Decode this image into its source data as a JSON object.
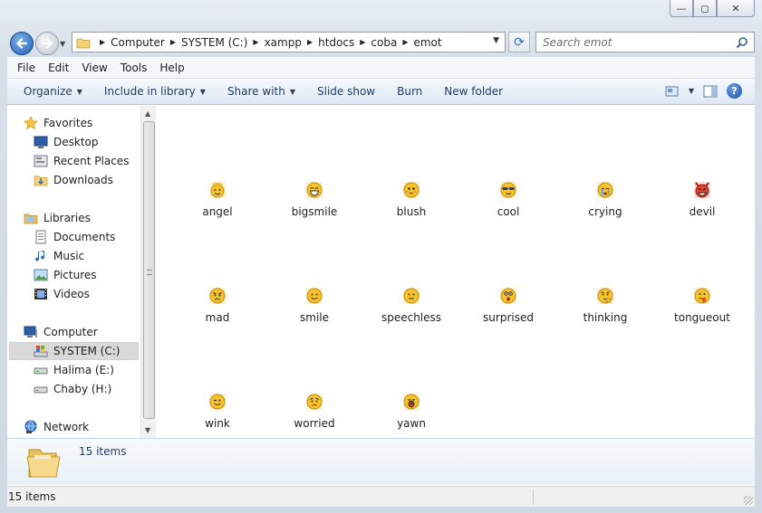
{
  "window": {
    "controls": {
      "minimize": "—",
      "maximize": "◻",
      "close": "✕"
    }
  },
  "address": {
    "breadcrumbs": [
      "Computer",
      "SYSTEM (C:)",
      "xampp",
      "htdocs",
      "coba",
      "emot"
    ]
  },
  "search": {
    "placeholder": "Search emot"
  },
  "menu": {
    "items": [
      "File",
      "Edit",
      "View",
      "Tools",
      "Help"
    ]
  },
  "toolbar": {
    "organize": "Organize",
    "include_in_library": "Include in library",
    "share_with": "Share with",
    "slide_show": "Slide show",
    "burn": "Burn",
    "new_folder": "New folder"
  },
  "nav": {
    "favorites": "Favorites",
    "desktop": "Desktop",
    "recent_places": "Recent Places",
    "downloads": "Downloads",
    "libraries": "Libraries",
    "documents": "Documents",
    "music": "Music",
    "pictures": "Pictures",
    "videos": "Videos",
    "computer": "Computer",
    "system_c": "SYSTEM (C:)",
    "halima_e": "Halima (E:)",
    "chaby_h": "Chaby (H:)",
    "network": "Network"
  },
  "files": [
    {
      "name": "angel",
      "icon": "angel-emoticon-icon"
    },
    {
      "name": "bigsmile",
      "icon": "bigsmile-emoticon-icon"
    },
    {
      "name": "blush",
      "icon": "blush-emoticon-icon"
    },
    {
      "name": "cool",
      "icon": "cool-emoticon-icon"
    },
    {
      "name": "crying",
      "icon": "crying-emoticon-icon"
    },
    {
      "name": "devil",
      "icon": "devil-emoticon-icon"
    },
    {
      "name": "mad",
      "icon": "mad-emoticon-icon"
    },
    {
      "name": "smile",
      "icon": "smile-emoticon-icon"
    },
    {
      "name": "speechless",
      "icon": "speechless-emoticon-icon"
    },
    {
      "name": "surprised",
      "icon": "surprised-emoticon-icon"
    },
    {
      "name": "thinking",
      "icon": "thinking-emoticon-icon"
    },
    {
      "name": "tongueout",
      "icon": "tongueout-emoticon-icon"
    },
    {
      "name": "wink",
      "icon": "wink-emoticon-icon"
    },
    {
      "name": "worried",
      "icon": "worried-emoticon-icon"
    },
    {
      "name": "yawn",
      "icon": "yawn-emoticon-icon"
    }
  ],
  "details": {
    "count": "15 items"
  },
  "status": {
    "text": "15 items"
  },
  "colors": {
    "accent": "#1f5fb3",
    "toolbar_text": "#1e3a5f",
    "emoticon": "#f7c22a"
  }
}
